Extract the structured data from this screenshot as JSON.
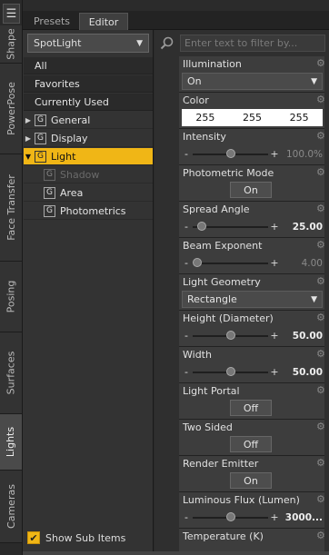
{
  "sidebar_tabs": [
    "Shape",
    "PowerPose",
    "Face Transfer",
    "Posing",
    "Surfaces",
    "Lights",
    "Cameras"
  ],
  "top_tabs": {
    "presets": "Presets",
    "editor": "Editor"
  },
  "preset_select": {
    "value": "SpotLight"
  },
  "categories": {
    "all": "All",
    "favorites": "Favorites",
    "currently_used": "Currently Used"
  },
  "tree": {
    "general": "General",
    "display": "Display",
    "light": "Light",
    "shadow": "Shadow",
    "area": "Area",
    "photometrics": "Photometrics",
    "group_icon": "G"
  },
  "show_sub_items": "Show Sub Items",
  "search": {
    "placeholder": "Enter text to filter by..."
  },
  "properties": {
    "illumination": {
      "label": "Illumination",
      "value": "On"
    },
    "color": {
      "label": "Color",
      "r": "255",
      "g": "255",
      "b": "255"
    },
    "intensity": {
      "label": "Intensity",
      "value": "100.0%",
      "level": 0.5
    },
    "photometric_mode": {
      "label": "Photometric Mode",
      "value": "On"
    },
    "spread_angle": {
      "label": "Spread Angle",
      "value": "25.00",
      "level": 0.14
    },
    "beam_exponent": {
      "label": "Beam Exponent",
      "value": "4.00",
      "level": 0.08
    },
    "light_geometry": {
      "label": "Light Geometry",
      "value": "Rectangle"
    },
    "height": {
      "label": "Height (Diameter)",
      "value": "50.00",
      "level": 0.5
    },
    "width": {
      "label": "Width",
      "value": "50.00",
      "level": 0.5
    },
    "light_portal": {
      "label": "Light Portal",
      "value": "Off"
    },
    "two_sided": {
      "label": "Two Sided",
      "value": "Off"
    },
    "render_emitter": {
      "label": "Render Emitter",
      "value": "On"
    },
    "luminous_flux": {
      "label": "Luminous Flux (Lumen)",
      "value": "3000...",
      "level": 0.5
    },
    "temperature": {
      "label": "Temperature (K)"
    }
  },
  "slider_minus": "-",
  "slider_plus": "+"
}
